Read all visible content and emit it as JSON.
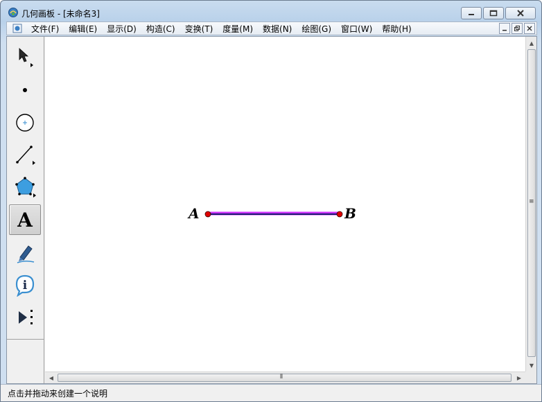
{
  "window": {
    "title": "几何画板 - [未命名3]"
  },
  "menu": {
    "items": [
      {
        "label": "文件(F)"
      },
      {
        "label": "编辑(E)"
      },
      {
        "label": "显示(D)"
      },
      {
        "label": "构造(C)"
      },
      {
        "label": "变换(T)"
      },
      {
        "label": "度量(M)"
      },
      {
        "label": "数据(N)"
      },
      {
        "label": "绘图(G)"
      },
      {
        "label": "窗口(W)"
      },
      {
        "label": "帮助(H)"
      }
    ]
  },
  "toolbox": {
    "tools": [
      {
        "icon": "arrow-select-icon"
      },
      {
        "icon": "point-icon"
      },
      {
        "icon": "compass-icon"
      },
      {
        "icon": "straightedge-icon"
      },
      {
        "icon": "polygon-icon"
      },
      {
        "icon": "text-icon",
        "glyph": "A",
        "selected": true
      },
      {
        "icon": "marker-icon"
      },
      {
        "icon": "information-icon",
        "glyph": "i"
      },
      {
        "icon": "custom-tool-icon"
      }
    ]
  },
  "sketch": {
    "point_a_label": "A",
    "point_b_label": "B",
    "segment_color": "#1a1a6e",
    "segment_highlight": "#cc33ff",
    "point_color": "#e00000"
  },
  "statusbar": {
    "text": "点击并拖动来创建一个说明"
  }
}
